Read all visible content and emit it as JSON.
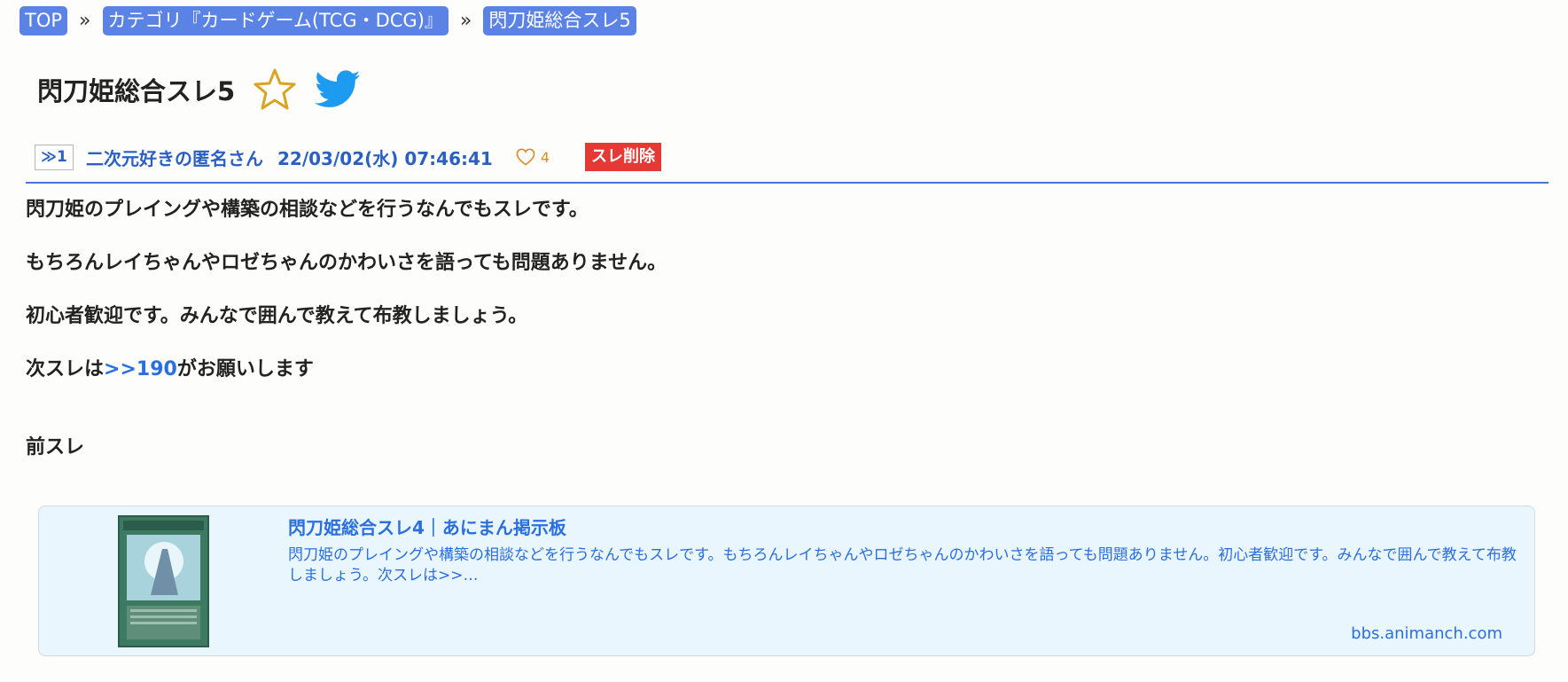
{
  "breadcrumb": {
    "items": [
      "TOP",
      "カテゴリ『カードゲーム(TCG・DCG)』",
      "閃刀姫総合スレ5"
    ],
    "separator": "»"
  },
  "thread": {
    "title": "閃刀姫総合スレ5"
  },
  "post": {
    "number": "≫1",
    "author": "二次元好きの匿名さん",
    "datetime": "22/03/02(水) 07:46:41",
    "likes": "4",
    "delete_label": "スレ削除",
    "lines": {
      "l1": "閃刀姫のプレイングや構築の相談などを行うなんでもスレです。",
      "l2": "もちろんレイちゃんやロゼちゃんのかわいさを語っても問題ありません。",
      "l3": "初心者歓迎です。みんなで囲んで教えて布教しましょう。",
      "l4_before": "次スレは",
      "l4_anchor": ">>190",
      "l4_after": "がお願いします",
      "l5": "前スレ"
    }
  },
  "link_card": {
    "title": "閃刀姫総合スレ4｜あにまん掲示板",
    "description": "閃刀姫のプレイングや構築の相談などを行うなんでもスレです。もちろんレイちゃんやロゼちゃんのかわいさを語っても問題ありません。初心者歓迎です。みんなで囲んで教えて布教しましょう。次スレは>>…",
    "domain": "bbs.animanch.com"
  },
  "colors": {
    "accent": "#5b83e6",
    "link": "#2a6fe0",
    "delete": "#e53935",
    "like": "#e08a2a",
    "card_bg": "#eaf6fd"
  },
  "icons": [
    "star-icon",
    "twitter-icon",
    "heart-icon"
  ]
}
